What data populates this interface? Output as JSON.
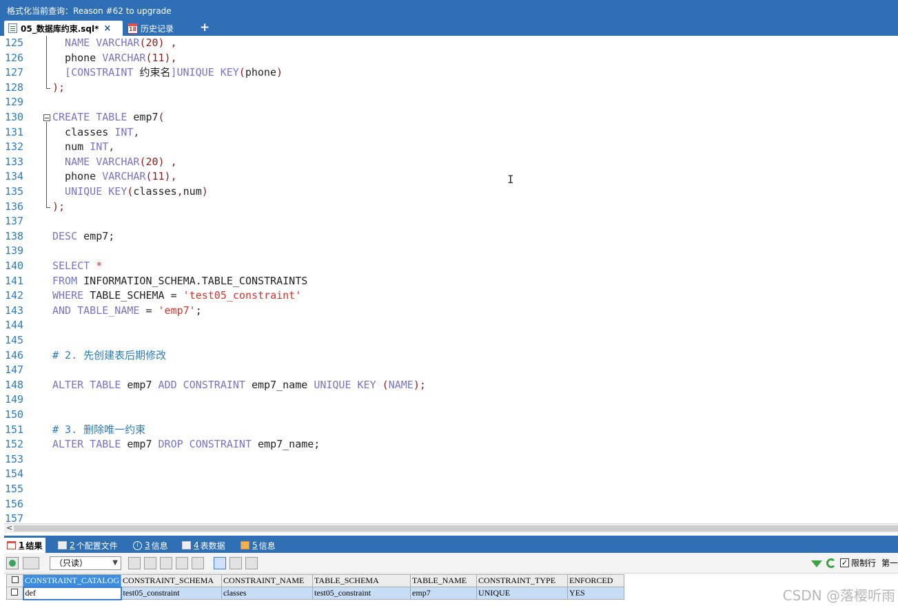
{
  "window": {
    "title": "格式化当前查询：Reason #62 to upgrade"
  },
  "tabs": [
    {
      "label": "05_数据库约束.sql*",
      "close": "×"
    },
    {
      "label": "历史记录",
      "icon_text": "18"
    }
  ],
  "add_tab": "+",
  "editor": {
    "lines": [
      {
        "n": "125",
        "tokens": [
          [
            "kw",
            "  NAME "
          ],
          [
            "kw",
            "VARCHAR"
          ],
          [
            "pn",
            "(20)"
          ],
          [
            "tx",
            " "
          ],
          [
            "pn",
            ","
          ]
        ]
      },
      {
        "n": "126",
        "tokens": [
          [
            "tx",
            "  phone "
          ],
          [
            "kw",
            "VARCHAR"
          ],
          [
            "pn",
            "(11),"
          ]
        ]
      },
      {
        "n": "127",
        "tokens": [
          [
            "kw",
            "  [CONSTRAINT "
          ],
          [
            "tx",
            "约束名"
          ],
          [
            "kw",
            "]UNIQUE KEY"
          ],
          [
            "pn",
            "("
          ],
          [
            "tx",
            "phone"
          ],
          [
            "pn",
            ")"
          ]
        ]
      },
      {
        "n": "128",
        "tokens": [
          [
            "pn",
            ");"
          ]
        ]
      },
      {
        "n": "129",
        "tokens": []
      },
      {
        "n": "130",
        "tokens": [
          [
            "kw",
            "CREATE TABLE "
          ],
          [
            "tx",
            "emp7"
          ],
          [
            "pn",
            "("
          ]
        ]
      },
      {
        "n": "131",
        "tokens": [
          [
            "tx",
            "  classes "
          ],
          [
            "kw",
            "INT"
          ],
          [
            "pn",
            ","
          ]
        ]
      },
      {
        "n": "132",
        "tokens": [
          [
            "tx",
            "  num "
          ],
          [
            "kw",
            "INT"
          ],
          [
            "pn",
            ","
          ]
        ]
      },
      {
        "n": "133",
        "tokens": [
          [
            "kw",
            "  NAME "
          ],
          [
            "kw",
            "VARCHAR"
          ],
          [
            "pn",
            "(20)"
          ],
          [
            "tx",
            " "
          ],
          [
            "pn",
            ","
          ]
        ]
      },
      {
        "n": "134",
        "tokens": [
          [
            "tx",
            "  phone "
          ],
          [
            "kw",
            "VARCHAR"
          ],
          [
            "pn",
            "(11),"
          ]
        ]
      },
      {
        "n": "135",
        "tokens": [
          [
            "kw",
            "  UNIQUE KEY"
          ],
          [
            "pn",
            "("
          ],
          [
            "tx",
            "classes"
          ],
          [
            "pn",
            ","
          ],
          [
            "tx",
            "num"
          ],
          [
            "pn",
            ")"
          ]
        ]
      },
      {
        "n": "136",
        "tokens": [
          [
            "pn",
            ");"
          ]
        ]
      },
      {
        "n": "137",
        "tokens": []
      },
      {
        "n": "138",
        "tokens": [
          [
            "kw",
            "DESC "
          ],
          [
            "tx",
            "emp7;"
          ]
        ]
      },
      {
        "n": "139",
        "tokens": []
      },
      {
        "n": "140",
        "tokens": [
          [
            "kw",
            "SELECT "
          ],
          [
            "st",
            "*"
          ]
        ]
      },
      {
        "n": "141",
        "tokens": [
          [
            "kw",
            "FROM "
          ],
          [
            "tx",
            "INFORMATION_SCHEMA.TABLE_CONSTRAINTS"
          ]
        ]
      },
      {
        "n": "142",
        "tokens": [
          [
            "kw",
            "WHERE "
          ],
          [
            "tx",
            "TABLE_SCHEMA = "
          ],
          [
            "st",
            "'test05_constraint'"
          ]
        ]
      },
      {
        "n": "143",
        "tokens": [
          [
            "kw",
            "AND TABLE_NAME "
          ],
          [
            "tx",
            "= "
          ],
          [
            "st",
            "'emp7'"
          ],
          [
            "tx",
            ";"
          ]
        ]
      },
      {
        "n": "144",
        "tokens": []
      },
      {
        "n": "145",
        "tokens": []
      },
      {
        "n": "146",
        "tokens": [
          [
            "cm",
            "# 2. 先创建表后期修改"
          ]
        ]
      },
      {
        "n": "147",
        "tokens": []
      },
      {
        "n": "148",
        "tokens": [
          [
            "kw",
            "ALTER TABLE "
          ],
          [
            "tx",
            "emp7 "
          ],
          [
            "kw",
            "ADD CONSTRAINT "
          ],
          [
            "tx",
            "emp7_name "
          ],
          [
            "kw",
            "UNIQUE KEY "
          ],
          [
            "pn",
            "("
          ],
          [
            "kw",
            "NAME"
          ],
          [
            "pn",
            ");"
          ]
        ]
      },
      {
        "n": "149",
        "tokens": []
      },
      {
        "n": "150",
        "tokens": []
      },
      {
        "n": "151",
        "tokens": [
          [
            "cm",
            "# 3. 删除唯一约束"
          ]
        ]
      },
      {
        "n": "152",
        "tokens": [
          [
            "kw",
            "ALTER TABLE "
          ],
          [
            "tx",
            "emp7 "
          ],
          [
            "kw",
            "DROP CONSTRAINT "
          ],
          [
            "tx",
            "emp7_name;"
          ]
        ]
      },
      {
        "n": "153",
        "tokens": []
      },
      {
        "n": "154",
        "tokens": []
      },
      {
        "n": "155",
        "tokens": []
      },
      {
        "n": "156",
        "tokens": []
      },
      {
        "n": "157",
        "tokens": []
      }
    ],
    "scroll_arrow": "<"
  },
  "result_tabs": [
    {
      "num": "1",
      "label": "结果"
    },
    {
      "num": "2",
      "label": "个配置文件"
    },
    {
      "num": "3",
      "label": "信息"
    },
    {
      "num": "4",
      "label": "表数据"
    },
    {
      "num": "5",
      "label": "信息"
    }
  ],
  "result_toolbar": {
    "mode": "（只读）",
    "limit_label": "限制行",
    "first_label": "第一"
  },
  "grid": {
    "columns": [
      "CONSTRAINT_CATALOG",
      "CONSTRAINT_SCHEMA",
      "CONSTRAINT_NAME",
      "TABLE_SCHEMA",
      "TABLE_NAME",
      "CONSTRAINT_TYPE",
      "ENFORCED"
    ],
    "rows": [
      [
        "def",
        "test05_constraint",
        "classes",
        "test05_constraint",
        "emp7",
        "UNIQUE",
        "YES"
      ]
    ]
  },
  "watermark": "CSDN @落樱听雨"
}
